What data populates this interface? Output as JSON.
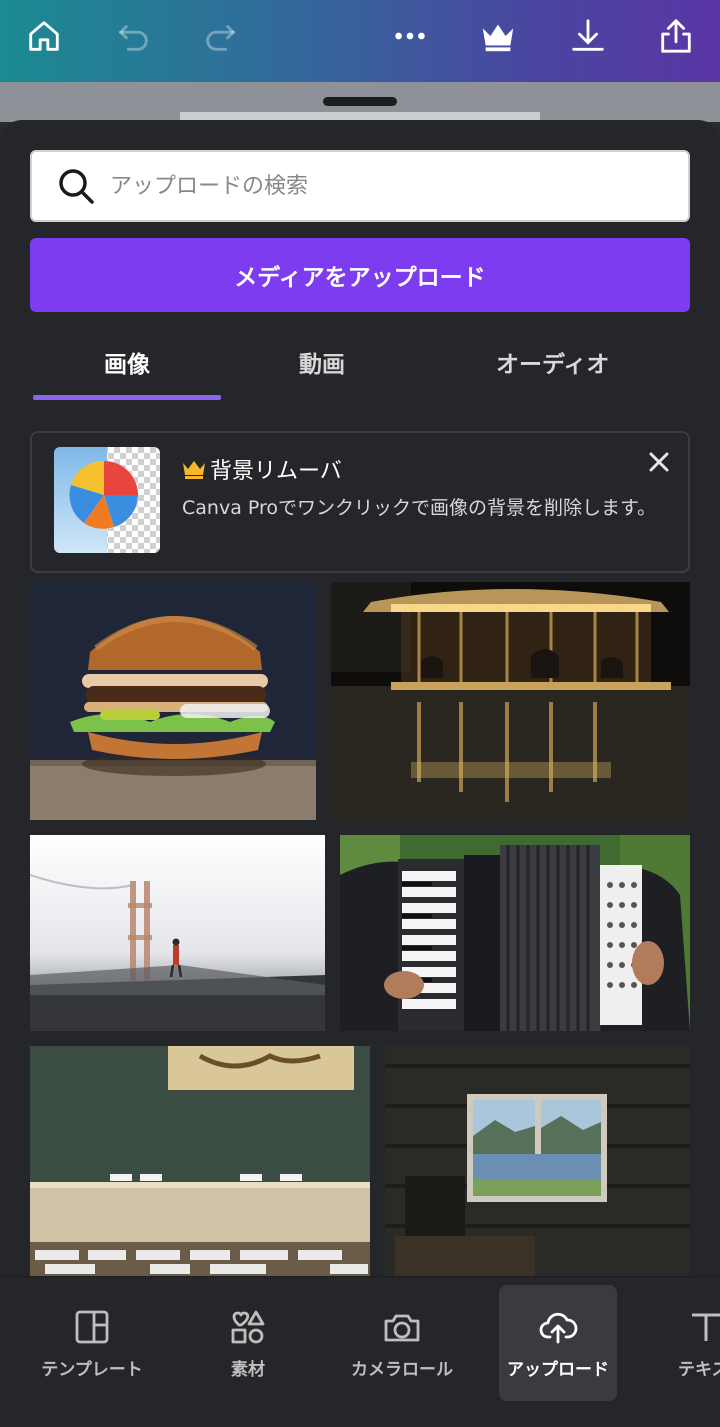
{
  "toolbar": {
    "icons": [
      "home-icon",
      "undo-icon",
      "redo-icon",
      "more-icon",
      "crown-icon",
      "download-icon",
      "share-icon"
    ],
    "gradient": [
      "#1b8a91",
      "#5a36a6"
    ]
  },
  "search": {
    "placeholder": "アップロードの検索"
  },
  "upload_button": {
    "label": "メディアをアップロード",
    "color": "#7d3cf0"
  },
  "tabs": [
    {
      "label": "画像",
      "active": true
    },
    {
      "label": "動画",
      "active": false
    },
    {
      "label": "オーディオ",
      "active": false
    }
  ],
  "promo": {
    "title": "背景リムーバ",
    "description": "Canva Proでワンクリックで画像の背景を削除します。"
  },
  "photos": [
    "burger-photo",
    "carousel-photo",
    "golden-gate-fog-photo",
    "accordion-photo",
    "conference-room-photo",
    "window-fjord-photo"
  ],
  "bottom_nav": [
    {
      "label": "テンプレート",
      "icon": "template-icon"
    },
    {
      "label": "素材",
      "icon": "elements-icon"
    },
    {
      "label": "カメラロール",
      "icon": "camera-icon"
    },
    {
      "label": "アップロード",
      "icon": "cloud-upload-icon",
      "active": true
    },
    {
      "label": "テキス",
      "icon": "text-icon"
    }
  ]
}
